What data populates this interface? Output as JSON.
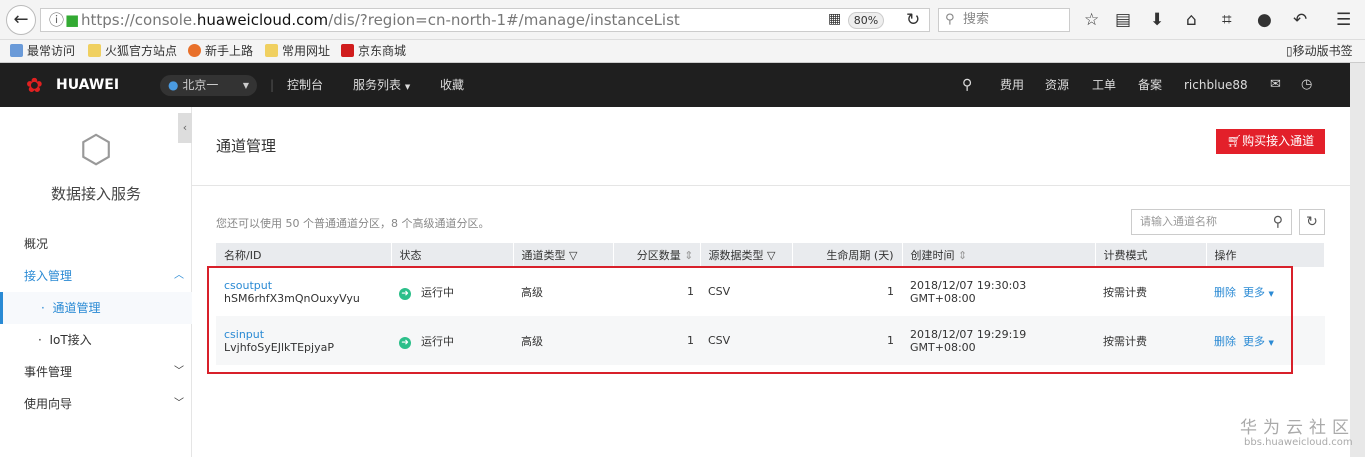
{
  "browser": {
    "url_host_pre": "https://console.",
    "url_host": "huaweicloud.com",
    "url_path": "/dis/?region=cn-north-1#/manage/instanceList",
    "zoom": "80%",
    "search_placeholder": "搜索",
    "bookmarks": [
      "最常访问",
      "火狐官方站点",
      "新手上路",
      "常用网址",
      "京东商城"
    ],
    "mobile_bookmarks": "移动版书签"
  },
  "nav": {
    "brand": "HUAWEI",
    "region": "北京一",
    "items": [
      "控制台",
      "服务列表",
      "收藏"
    ],
    "right": [
      "费用",
      "资源",
      "工单",
      "备案"
    ],
    "user": "richblue88"
  },
  "sidebar": {
    "service": "数据接入服务",
    "items": [
      {
        "label": "概况"
      },
      {
        "label": "接入管理"
      },
      {
        "label": "通道管理"
      },
      {
        "label": "IoT接入"
      },
      {
        "label": "事件管理"
      },
      {
        "label": "使用向导"
      }
    ]
  },
  "main": {
    "title": "通道管理",
    "buy_button": "购买接入通道",
    "quota": "您还可以使用 50 个普通通道分区，8 个高级通道分区。",
    "search_placeholder": "请输入通道名称",
    "columns": [
      "名称/ID",
      "状态",
      "通道类型",
      "分区数量",
      "源数据类型",
      "生命周期 (天)",
      "创建时间",
      "计费模式",
      "操作"
    ],
    "rows": [
      {
        "name": "csoutput",
        "id": "hSM6rhfX3mQnOuxyVyu",
        "status": "运行中",
        "type": "高级",
        "partitions": "1",
        "source": "CSV",
        "lifecycle": "1",
        "created": "2018/12/07 19:30:03 GMT+08:00",
        "billing": "按需计费",
        "delete": "删除",
        "more": "更多"
      },
      {
        "name": "csinput",
        "id": "LvjhfoSyEJlkTEpjyaP",
        "status": "运行中",
        "type": "高级",
        "partitions": "1",
        "source": "CSV",
        "lifecycle": "1",
        "created": "2018/12/07 19:29:19 GMT+08:00",
        "billing": "按需计费",
        "delete": "删除",
        "more": "更多"
      }
    ]
  },
  "watermark": {
    "title": "华为云社区",
    "url": "bbs.huaweicloud.com"
  }
}
